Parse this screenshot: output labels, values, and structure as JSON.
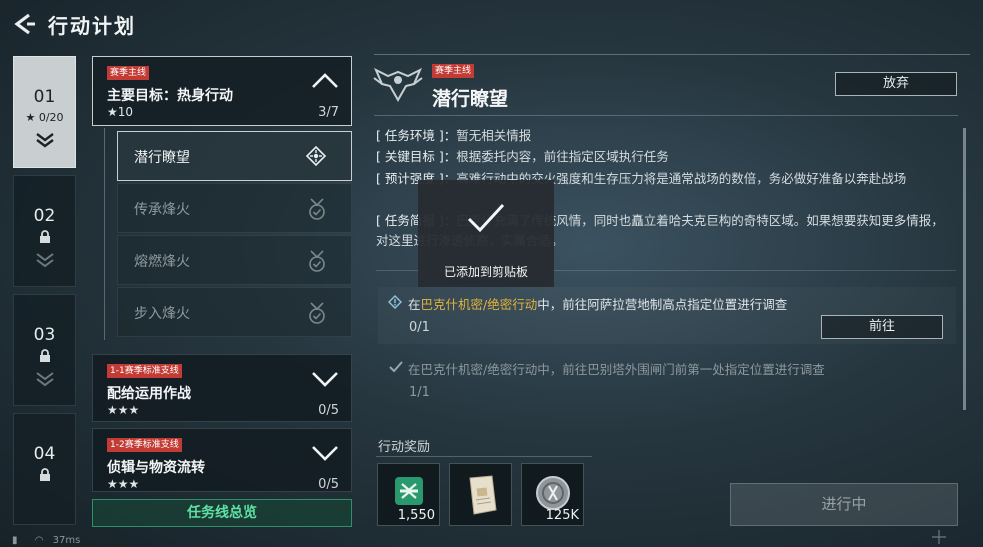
{
  "header": {
    "title": "行动计划"
  },
  "chapters": [
    {
      "number": "01",
      "progress": "0/20",
      "active": true,
      "locked": false
    },
    {
      "number": "02",
      "locked": true
    },
    {
      "number": "03",
      "locked": true
    },
    {
      "number": "04",
      "locked": true
    }
  ],
  "missions": [
    {
      "tag": "赛季主线",
      "title": "主要目标：热身行动",
      "stars": "★10",
      "progress": "3/7",
      "expanded": true
    },
    {
      "tag": "1-1赛季标准支线",
      "title": "配给运用作战",
      "stars": "★★★",
      "progress": "0/5",
      "expanded": false
    },
    {
      "tag": "1-2赛季标准支线",
      "title": "侦辑与物资流转",
      "stars": "★★★",
      "progress": "0/5",
      "expanded": false
    }
  ],
  "submissions": [
    {
      "label": "潜行瞭望",
      "active": true,
      "icon": "target-icon"
    },
    {
      "label": "传承烽火",
      "active": false,
      "icon": "badge-check-icon"
    },
    {
      "label": "熔燃烽火",
      "active": false,
      "icon": "badge-check-icon"
    },
    {
      "label": "步入烽火",
      "active": false,
      "icon": "badge-check-icon"
    }
  ],
  "overview_button": "任务线总览",
  "detail": {
    "tag": "赛季主线",
    "title": "潜行瞭望",
    "abandon_label": "放弃",
    "env_key": "[ 任务环境 ]：",
    "env_val": "暂无相关情报",
    "goal_key": "[ 关键目标 ]：",
    "goal_val": "根据委托内容，前往指定区域执行任务",
    "intensity_key": "[ 预计强度 ]：",
    "intensity_val": "高难行动中的交火强度和生存压力将是通常战场的数倍，务必做好准备以奔赴战场",
    "brief_key": "[ 任务简报 ]：",
    "brief_val": "巴克什充满了传统风情，同时也矗立着哈夫克巨构的奇特区域。如果想要获知更多情报，对这里进行渗透侦察，实属合适。"
  },
  "objectives": [
    {
      "prefix": "在",
      "highlight": "巴克什机密/绝密行动",
      "text": "中，前往阿萨拉营地制高点指定位置进行调查",
      "progress": "0/1",
      "done": false,
      "button": "前往"
    },
    {
      "prefix": "在",
      "highlight": "巴克什机密/绝密行动",
      "text": "中，前往巴别塔外围闸门前第一处指定位置进行调查",
      "progress": "1/1",
      "done": true
    }
  ],
  "rewards": {
    "label": "行动奖励",
    "items": [
      {
        "icon": "exp-crate-icon",
        "count": "1,550",
        "color": "#2a9a6e"
      },
      {
        "icon": "document-icon",
        "count": ""
      },
      {
        "icon": "coin-icon",
        "count": "125K"
      }
    ]
  },
  "status_button": "进行中",
  "toast": {
    "text": "已添加到剪贴板"
  },
  "status_bar": {
    "ping": "37ms"
  }
}
